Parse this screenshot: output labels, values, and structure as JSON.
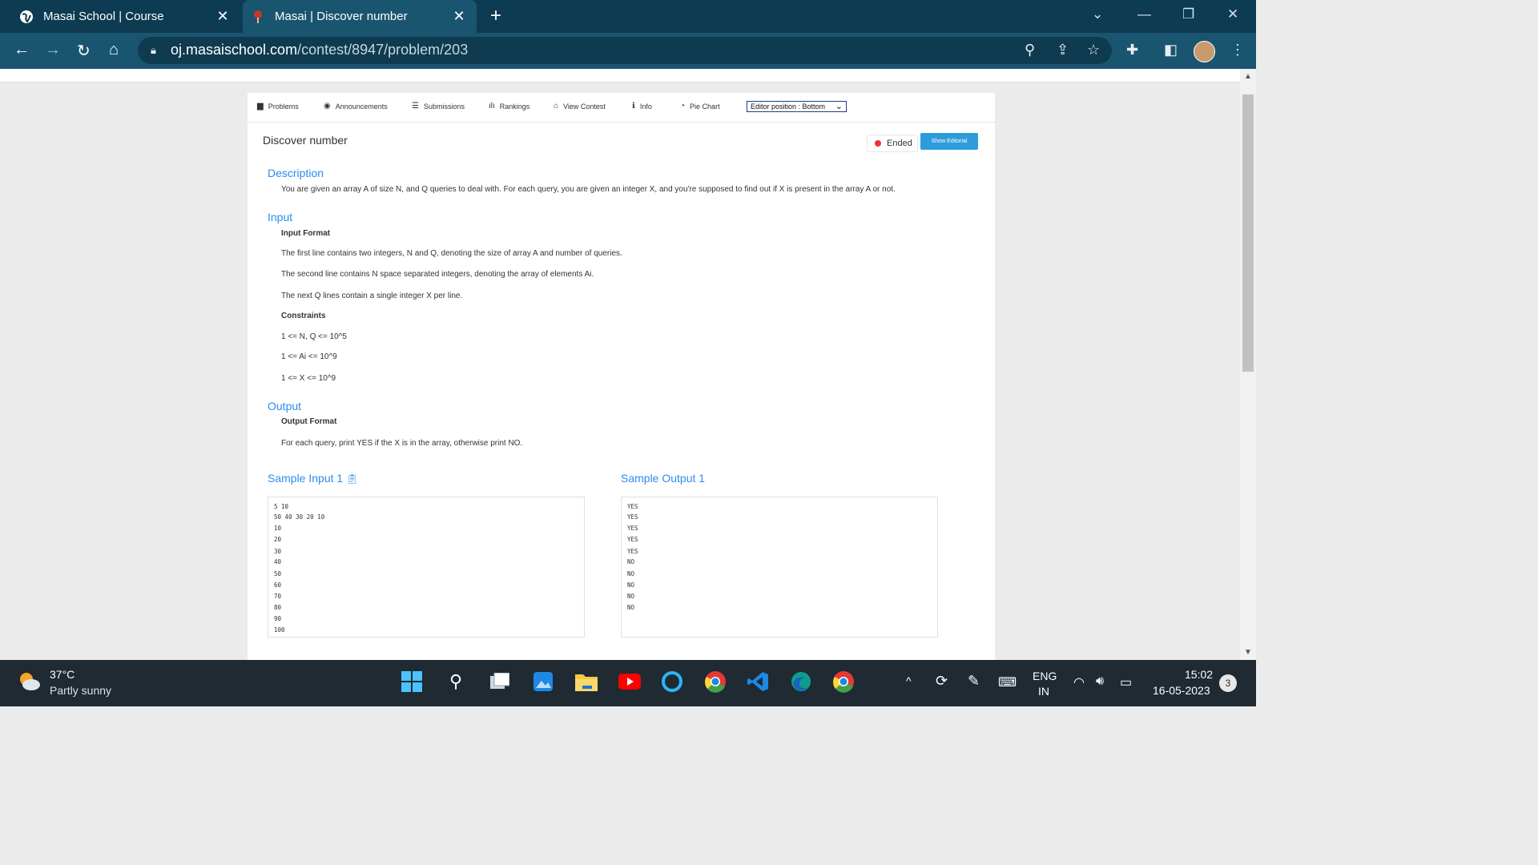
{
  "browser": {
    "tabs": [
      {
        "title": "Masai School | Course",
        "active": false
      },
      {
        "title": "Masai | Discover number",
        "active": true
      }
    ],
    "new_tab": "+",
    "url_host": "oj.masaischool.com",
    "url_path": "/contest/8947/problem/203"
  },
  "nav": {
    "items": [
      {
        "label": "Problems",
        "icon": "▆"
      },
      {
        "label": "Announcements",
        "icon": "◉"
      },
      {
        "label": "Submissions",
        "icon": "☰"
      },
      {
        "label": "Rankings",
        "icon": "ılı"
      },
      {
        "label": "View Contest",
        "icon": "⌂"
      },
      {
        "label": "Info",
        "icon": "ℹ"
      },
      {
        "label": "Pie Chart",
        "icon": "◔"
      }
    ],
    "editor_position": "Editor position : Bottom"
  },
  "problem": {
    "title": "Discover number",
    "status": "Ended",
    "editorial_button": "Show Editorial",
    "description_heading": "Description",
    "description": "You are given an array A of size N, and Q queries to deal with. For each query, you are given an integer X, and you're supposed to find out if X is present in the array A or not.",
    "input_heading": "Input",
    "input_format_heading": "Input Format",
    "input_lines": [
      "The first line contains two integers, N and Q, denoting the size of array A and number of queries.",
      "The second line contains N space separated integers, denoting the array of elements Ai.",
      "The next Q lines contain a single integer X per line."
    ],
    "constraints_heading": "Constraints",
    "constraints": [
      "1 <= N, Q <= 10^5",
      "1 <= Ai <= 10^9",
      "1 <= X <= 10^9"
    ],
    "output_heading": "Output",
    "output_format_heading": "Output Format",
    "output_line": "For each query, print YES if the X is in the array, otherwise print NO.",
    "sample_input_heading": "Sample Input 1",
    "sample_output_heading": "Sample Output 1",
    "sample_input": [
      "5 10",
      "50 40 30 20 10",
      "10",
      "20",
      "30",
      "40",
      "50",
      "60",
      "70",
      "80",
      "90",
      "100"
    ],
    "sample_output": [
      "YES",
      "YES",
      "YES",
      "YES",
      "YES",
      "NO",
      "NO",
      "NO",
      "NO",
      "NO"
    ]
  },
  "taskbar": {
    "temperature": "37°C",
    "weather": "Partly sunny",
    "language": "ENG",
    "region": "IN",
    "time": "15:02",
    "date": "16-05-2023",
    "notifications": "3"
  }
}
